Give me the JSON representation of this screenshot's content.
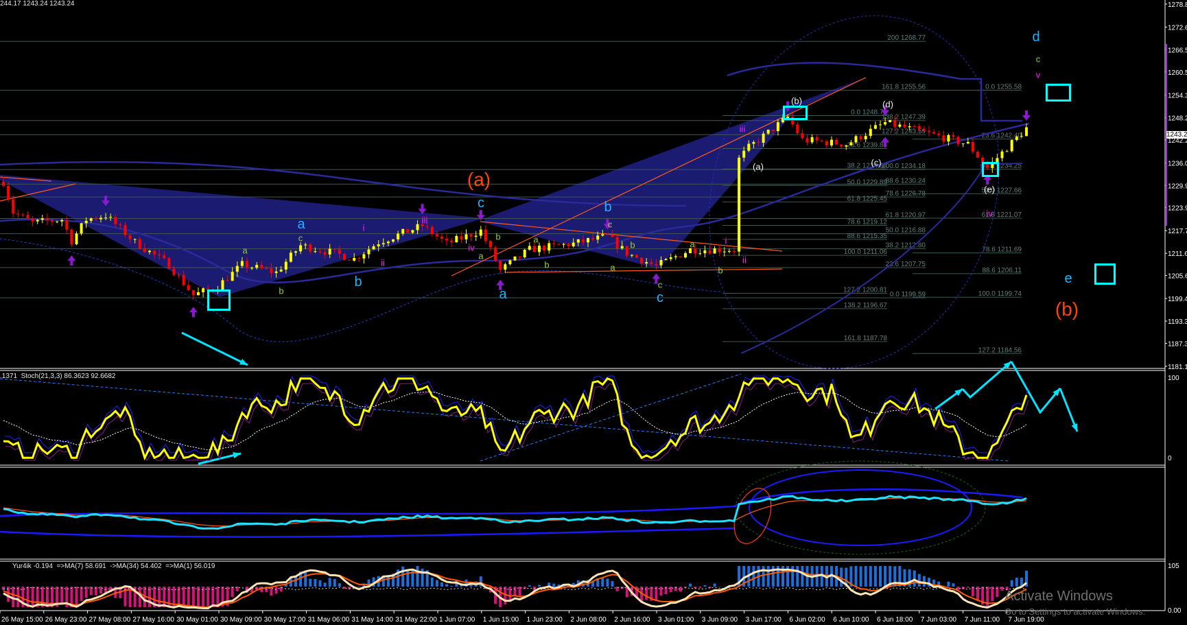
{
  "headers": {
    "main": "244.17 1243.24 1243.24",
    "stoch": ".1371  Stoch(21,3,3) 86.3623 92.6682",
    "osc": "Yur4ik -0.194  =>MA(7) 58.691  ->MA(34) 54.402  =>MA(1) 56.019"
  },
  "current_price": "1243.2",
  "price_axis": [
    "1278.8",
    "1272.6",
    "1266.5",
    "1260.5",
    "1254.3",
    "1248.2",
    "1242.2",
    "1236.0",
    "1229.9",
    "1223.9",
    "1217.7",
    "1211.6",
    "1205.6",
    "1199.4",
    "1193.3",
    "1187.3",
    "1181.1"
  ],
  "stoch_axis": [
    "100",
    "0"
  ],
  "osc_axis": [
    "105",
    "0.00"
  ],
  "time_axis": [
    "26 May 15:00",
    "26 May 23:00",
    "27 May 08:00",
    "27 May 16:00",
    "30 May 01:00",
    "30 May 09:00",
    "30 May 17:00",
    "31 May 06:00",
    "31 May 14:00",
    "31 May 22:00",
    "1 Jun 07:00",
    "1 Jun 15:00",
    "1 Jun 23:00",
    "2 Jun 08:00",
    "2 Jun 16:00",
    "3 Jun 01:00",
    "3 Jun 09:00",
    "3 Jun 17:00",
    "6 Jun 02:00",
    "6 Jun 10:00",
    "6 Jun 18:00",
    "7 Jun 03:00",
    "7 Jun 11:00",
    "7 Jun 19:00"
  ],
  "fib_sets": [
    [
      "200 1268.77",
      "161.8 1255.56",
      "138.2 1247.39",
      "127.2 1243.59",
      "100.0 1234.18",
      "88.6 1230.24",
      "78.6 1226.78",
      "61.8 1220.97",
      "50.0 1216.88",
      "38.2 1212.80",
      "23.6 1207.75",
      "0.0 1199.59"
    ],
    [
      "0.0 1248.73",
      "23.6 1239.84",
      "38.2 1234.34",
      "50.0 1229.89",
      "61.8 1225.45",
      "78.6 1219.12",
      "88.6 1215.35",
      "100.0 1211.06",
      "127.2 1200.81",
      "138.2 1196.67",
      "161.8 1187.78"
    ],
    [
      "0.0 1255.58",
      "23.6 1242.40",
      "38.2 1234.25",
      "50.0 1227.66",
      "61.8 1221.07",
      "78.6 1211.69",
      "88.6 1206.11",
      "100.0 1199.74",
      "127.2 1184.56"
    ]
  ],
  "waves": [
    {
      "text": "(a)"
    },
    {
      "text": "(b)"
    },
    {
      "text": "a"
    },
    {
      "text": "b"
    },
    {
      "text": "c"
    },
    {
      "text": "a"
    },
    {
      "text": "b"
    },
    {
      "text": "c"
    },
    {
      "text": "d"
    },
    {
      "text": "e"
    },
    {
      "text": "a"
    },
    {
      "text": "c"
    },
    {
      "text": "b"
    },
    {
      "text": "b"
    },
    {
      "text": "a"
    },
    {
      "text": "a"
    },
    {
      "text": "b"
    },
    {
      "text": "c"
    },
    {
      "text": "b"
    },
    {
      "text": "a"
    },
    {
      "text": "c"
    },
    {
      "text": "a"
    },
    {
      "text": "b"
    },
    {
      "text": "c"
    },
    {
      "text": "i"
    },
    {
      "text": "ii"
    },
    {
      "text": "iii"
    },
    {
      "text": "iv"
    },
    {
      "text": "iii"
    },
    {
      "text": "i"
    },
    {
      "text": "ii"
    },
    {
      "text": "iv"
    },
    {
      "text": "v"
    },
    {
      "text": "(a)"
    },
    {
      "text": "(b)"
    },
    {
      "text": "(c)"
    },
    {
      "text": "(d)"
    },
    {
      "text": "(e)"
    }
  ],
  "watermark": {
    "title": "Activate Windows",
    "subtitle": "Go to Settings to activate Windows."
  },
  "colors": {
    "bull": "#ffff00",
    "bear": "#ff0000",
    "pattern": "#1c1c78",
    "cyan": "#00ffff"
  },
  "chart_data": {
    "type": "line",
    "title": "Price candles with Elliott-wave annotations",
    "ylim": [
      1181.1,
      1278.8
    ],
    "price_path": [
      [
        0,
        1230.9
      ],
      [
        2,
        1222.7
      ],
      [
        6,
        1219.8
      ],
      [
        12,
        1220.7
      ],
      [
        14,
        1215.0
      ],
      [
        17,
        1220.7
      ],
      [
        21,
        1221.8
      ],
      [
        27,
        1214.6
      ],
      [
        34,
        1208.5
      ],
      [
        39,
        1200.3
      ],
      [
        44,
        1202.7
      ],
      [
        49,
        1208.5
      ],
      [
        56,
        1206.4
      ],
      [
        61,
        1213.7
      ],
      [
        68,
        1211.6
      ],
      [
        72,
        1210.1
      ],
      [
        77,
        1214.6
      ],
      [
        86,
        1219.0
      ],
      [
        91,
        1214.2
      ],
      [
        98,
        1217.7
      ],
      [
        102,
        1207.0
      ],
      [
        108,
        1212.6
      ],
      [
        117,
        1214.2
      ],
      [
        124,
        1216.1
      ],
      [
        128,
        1211.6
      ],
      [
        134,
        1208.1
      ],
      [
        141,
        1212.6
      ],
      [
        150,
        1212.6
      ],
      [
        151,
        1237.0
      ],
      [
        153,
        1240.1
      ],
      [
        161,
        1248.3
      ],
      [
        164,
        1242.2
      ],
      [
        173,
        1241.0
      ],
      [
        181,
        1246.8
      ],
      [
        189,
        1244.2
      ],
      [
        198,
        1241.0
      ],
      [
        202,
        1234.6
      ],
      [
        206,
        1240.1
      ],
      [
        210,
        1245.3
      ]
    ],
    "stoch_range": [
      0,
      100
    ],
    "osc_range": [
      0,
      105
    ]
  }
}
